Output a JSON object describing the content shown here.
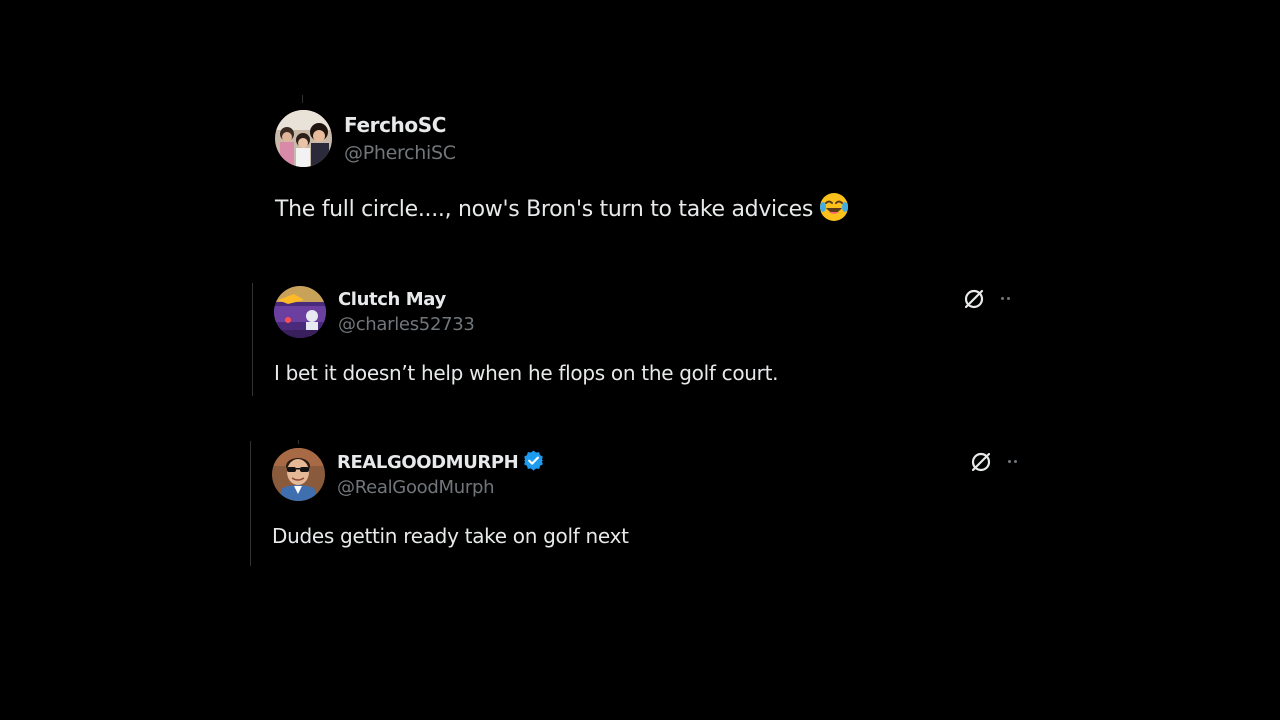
{
  "tweets": [
    {
      "display_name": "FerchoSC",
      "handle": "@PherchiSC",
      "text": "The full circle...., now's Bron's turn to take advices",
      "emoji": "face-with-tears-of-joy",
      "verified": false,
      "avatar": "group-photo-avatar"
    },
    {
      "display_name": "Clutch May",
      "handle": "@charles52733",
      "text": "I bet it doesn’t help when he flops on the golf court.",
      "verified": false,
      "avatar": "purple-gold-graphic-avatar",
      "actions": [
        "grok-icon",
        "more-icon"
      ]
    },
    {
      "display_name": "REALGOODMURPH",
      "handle": "@RealGoodMurph",
      "text": "Dudes gettin ready take on golf next",
      "verified": true,
      "avatar": "man-sunglasses-avatar",
      "actions": [
        "grok-icon",
        "more-icon"
      ]
    }
  ],
  "colors": {
    "background": "#000000",
    "primary_text": "#e7e9ea",
    "secondary_text": "#71767b",
    "verified_blue": "#1d9bf0",
    "thread_line": "#2f3336"
  }
}
